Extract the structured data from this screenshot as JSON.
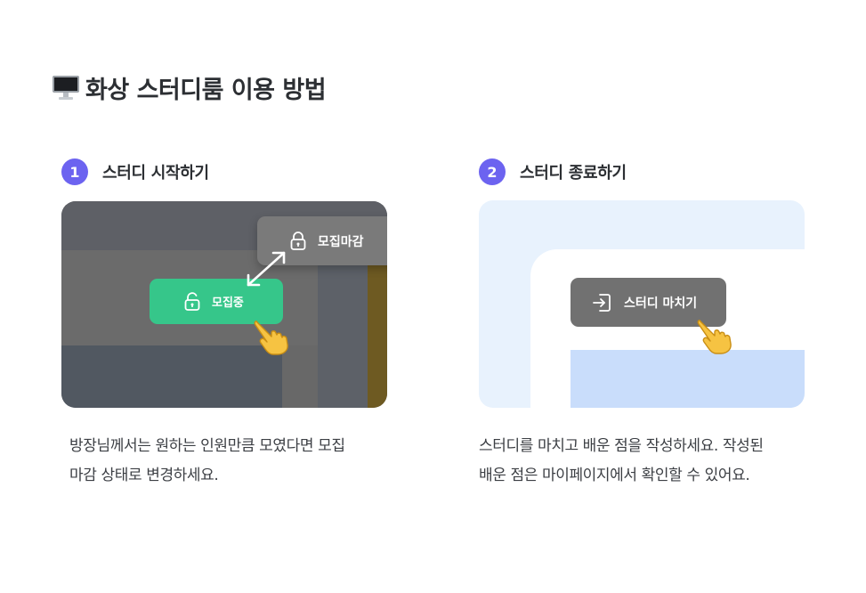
{
  "header": {
    "icon": "desktop-computer-icon",
    "title": "화상 스터디룸 이용 방법"
  },
  "steps": [
    {
      "number": "1",
      "label": "스터디 시작하기",
      "illustration": {
        "open_pill_label": "모집중",
        "closed_pill_label": "모집마감",
        "icons": [
          "unlock-icon",
          "lock-icon",
          "swap-arrow-icon",
          "pointing-hand-icon"
        ]
      },
      "description_lines": [
        "방장님께서는 원하는 인원만큼 모였다면 모집",
        "마감 상태로 변경하세요."
      ]
    },
    {
      "number": "2",
      "label": "스터디 종료하기",
      "illustration": {
        "end_button_label": "스터디 마치기",
        "icons": [
          "exit-icon",
          "pointing-hand-icon"
        ]
      },
      "description_lines": [
        "스터디를 마치고 배운 점을 작성하세요. 작성된",
        "배운 점은 마이페이지에서 확인할 수 있어요."
      ]
    }
  ],
  "colors": {
    "accent": "#6c63f0",
    "recruiting_green": "#36c68a",
    "closed_gray": "#7a7a7a",
    "end_button_gray": "#717171",
    "card2_background": "#e8f2fd"
  }
}
